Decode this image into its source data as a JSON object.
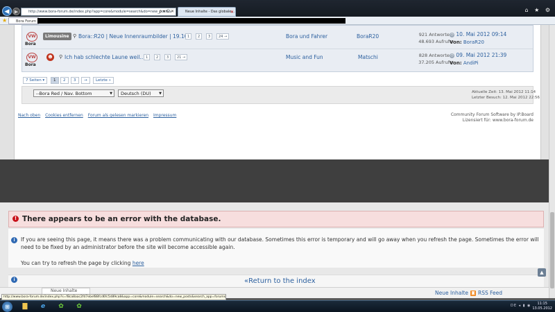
{
  "browser": {
    "address": "http://www.bora-forum.de/index.php?app=core&module=search&do=new_posts&",
    "addr_controls": "ρ ▾ C ✕",
    "tab1": "Neue Inhalte - Das globale...",
    "tab_close": "✕",
    "fav_tab": "Bora Forum",
    "win_icons": "⌂ ★ ⚙"
  },
  "topics": [
    {
      "prefix": "Limousine",
      "title": "Bora::R20 | Neue Innenraumbilder | 19.10.",
      "pages": [
        "1",
        "2",
        "3",
        "24 →"
      ],
      "forum": "Bora und Fahrer",
      "starter": "BoraR20",
      "replies": "921 Antworten",
      "views": "48.693 Aufrufe",
      "last_date": "10. Mai 2012 09:14",
      "last_by_label": "Von:",
      "last_by": "BoraR20"
    },
    {
      "prefix": "",
      "title": "Ich hab schlechte Laune weil...",
      "pages": [
        "1",
        "2",
        "3",
        "21 →"
      ],
      "forum": "Music and Fun",
      "starter": "Matschi",
      "replies": "828 Antworten",
      "views": "37.205 Aufrufe",
      "last_date": "09. Mai 2012 21:39",
      "last_by_label": "Von:",
      "last_by": "AndiPi"
    }
  ],
  "bora_label": "Bora",
  "pagination": {
    "pages_label": "7 Seiten ▾",
    "page1": "1",
    "page2": "2",
    "page3": "3",
    "next": "→",
    "last": "Letzte »"
  },
  "util": {
    "skin": "--Bora Red / Nav. Bottom",
    "language": "Deutsch (DU)",
    "time_now": "Aktuelle Zeit: 13. Mai 2012 11:14",
    "last_visit": "Letzter Besuch: 12. Mai 2012 22:56"
  },
  "footer": {
    "links": [
      "Nach oben",
      "Cookies entfernen",
      "Forum als gelesen markieren",
      "Impressum"
    ],
    "credit1": "Community Forum Software by IP.Board",
    "credit2": "Lizensiert für: www.bora-forum.de"
  },
  "error": {
    "title": "There appears to be an error with the database.",
    "text": "If you are seeing this page, it means there was a problem communicating with our database. Sometimes this error is temporary and will go away when you refresh the page. Sometimes the error will need to be fixed by an administrator before the site will become accessible again.",
    "retry_prefix": "You can try to refresh the page by clicking ",
    "retry_link": "here",
    "return_link": "«Return to the index"
  },
  "bottom": {
    "card_text": "Neue Inhalte",
    "neue_inhalte": "Neue Inhalte",
    "rss": "RSS Feed",
    "status_url": "http://www.bora-forum.de/index.php?s=f8ca8aac2fd7ebef88fcd6fc5d89ca8&app=core&module=search&do=new_posts&search_app=forums"
  },
  "taskbar": {
    "tray": "DE ◂ ▮ ◉",
    "time": "11:15",
    "date": "13.05.2012"
  }
}
